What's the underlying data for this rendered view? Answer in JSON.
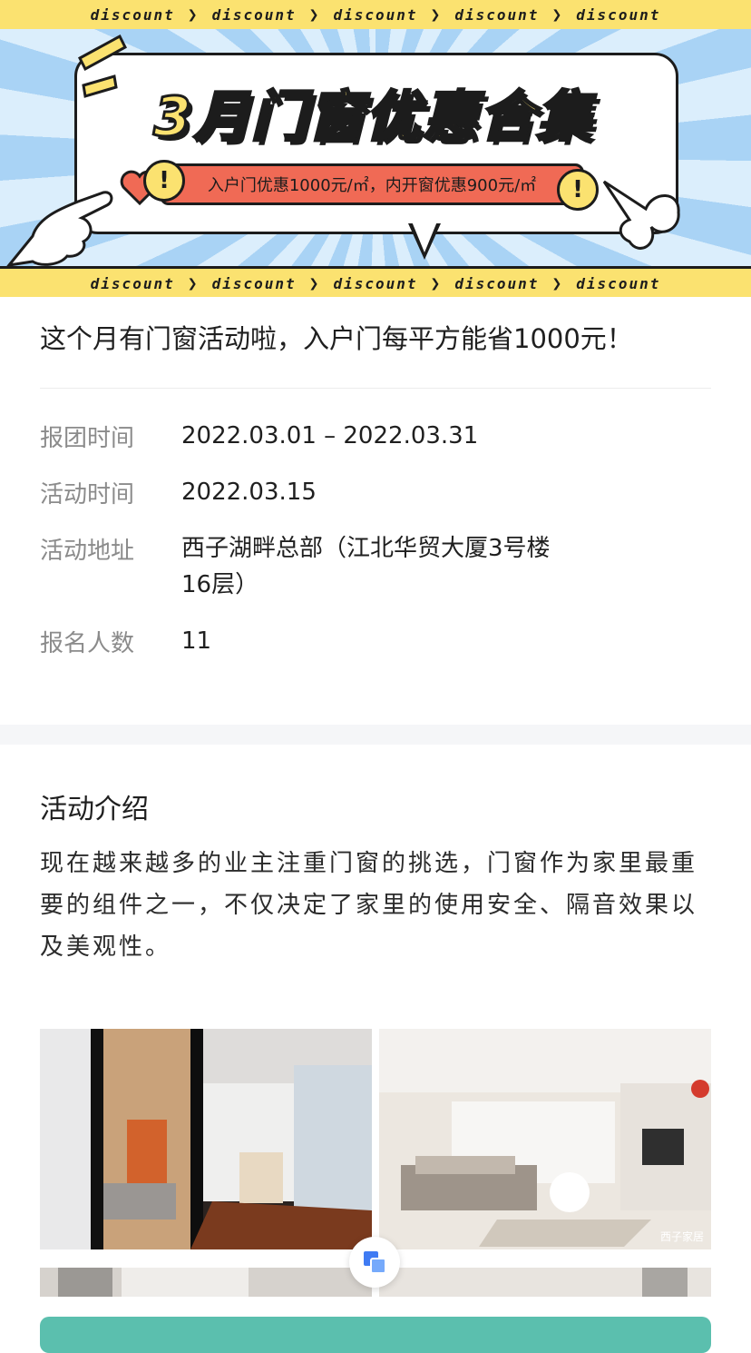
{
  "banner": {
    "strip_word": "discount",
    "strip_repeat": [
      "discount",
      "discount",
      "discount",
      "discount",
      "discount"
    ],
    "title": "3月门窗优惠合集",
    "promo": "入户门优惠1000元/㎡，内开窗优惠900元/㎡",
    "badge_mark": "!"
  },
  "event": {
    "headline": "这个月有门窗活动啦，入户门每平方能省1000元！",
    "rows": [
      {
        "label": "报团时间",
        "value": "2022.03.01 – 2022.03.31"
      },
      {
        "label": "活动时间",
        "value": "2022.03.15"
      },
      {
        "label": "活动地址",
        "value": "西子湖畔总部（江北华贸大厦3号楼16层）"
      },
      {
        "label": "报名人数",
        "value": "11"
      }
    ]
  },
  "intro": {
    "title": "活动介绍",
    "body": "现在越来越多的业主注重门窗的挑选，门窗作为家里最重要的组件之一，不仅决定了家里的使用安全、隔音效果以及美观性。"
  },
  "gallery": {
    "watermark": "西子家居",
    "float_icon": "copy-icon"
  },
  "colors": {
    "accent_yellow": "#fbe270",
    "accent_red": "#f06a55",
    "sky_blue": "#a9d3f5",
    "cta_teal": "#5bbfae",
    "label_gray": "#8b8b8b"
  }
}
